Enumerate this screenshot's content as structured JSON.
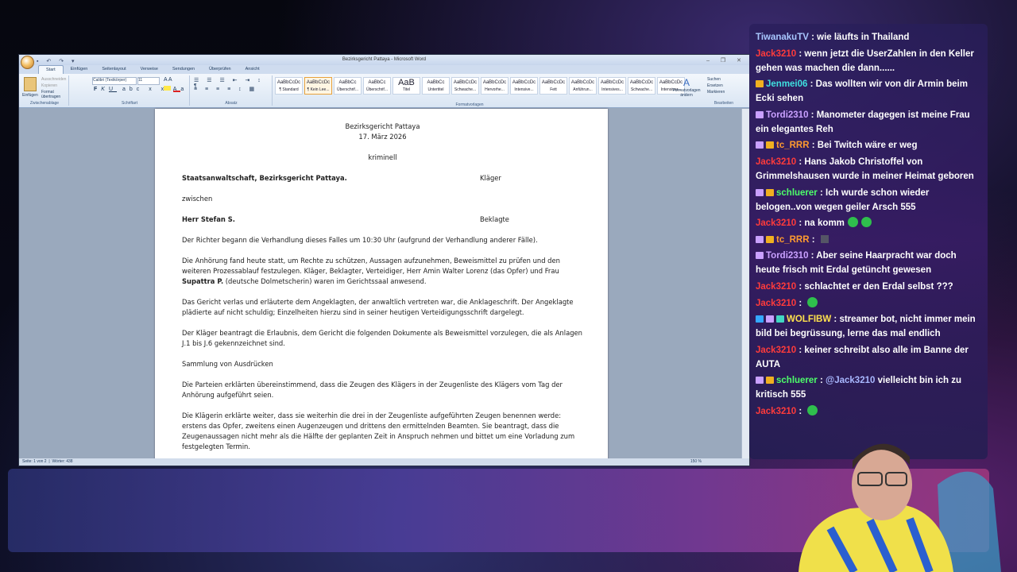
{
  "word": {
    "window_title": "Bezirksgericht Pattaya - Microsoft Word",
    "tabs": [
      "Start",
      "Einfügen",
      "Seitenlayout",
      "Verweise",
      "Sendungen",
      "Überprüfen",
      "Ansicht"
    ],
    "clipboard": {
      "paste": "Einfügen",
      "cut": "Ausschneiden",
      "copy": "Kopieren",
      "format_painter": "Format übertragen",
      "group": "Zwischenablage"
    },
    "font": {
      "name": "Calibri (Textkörper)",
      "size": "11",
      "group": "Schriftart"
    },
    "paragraph_group": "Absatz",
    "styles": [
      {
        "preview": "AaBbCcDc",
        "name": "¶ Standard"
      },
      {
        "preview": "AaBbCcDc",
        "name": "¶ Kein Lee..."
      },
      {
        "preview": "AaBbCc",
        "name": "Überschrif..."
      },
      {
        "preview": "AaBbCc",
        "name": "Überschrif..."
      },
      {
        "preview": "AaB",
        "name": "Titel"
      },
      {
        "preview": "AaBbCc",
        "name": "Untertitel"
      },
      {
        "preview": "AaBbCcDc",
        "name": "Schwache..."
      },
      {
        "preview": "AaBbCcDc",
        "name": "Hervorhe..."
      },
      {
        "preview": "AaBbCcDc",
        "name": "Intensive..."
      },
      {
        "preview": "AaBbCcDc",
        "name": "Fett"
      },
      {
        "preview": "AaBbCcDc",
        "name": "Anführun..."
      },
      {
        "preview": "AaBbCcDc",
        "name": "Intensives..."
      },
      {
        "preview": "AaBbCcDc",
        "name": "Schwache..."
      },
      {
        "preview": "AaBbCcDc",
        "name": "Intensiver..."
      }
    ],
    "styles_group": "Formatvorlagen",
    "change_styles": "Formatvorlagen ändern",
    "editing": {
      "find": "Suchen",
      "replace": "Ersetzen",
      "select": "Markieren",
      "group": "Bearbeiten"
    },
    "status": {
      "page": "Seite: 1 von 2",
      "words": "Wörter: 438",
      "zoom": "150 %"
    },
    "document": {
      "heading": "Bezirksgericht Pattaya",
      "date": "17. März 2026",
      "category": "kriminell",
      "party1": "Staatsanwaltschaft, Bezirksgericht Pattaya.",
      "party1_role": "Kläger",
      "between": "zwischen",
      "party2": "Herr Stefan S.",
      "party2_role": "Beklagte",
      "p1": "Der Richter begann die Verhandlung dieses Falles um 10:30 Uhr (aufgrund der Verhandlung anderer Fälle).",
      "p2a": "Die Anhörung fand heute statt, um Rechte zu schützen, Aussagen aufzunehmen, Beweismittel zu prüfen und den weiteren Prozessablauf festzulegen. Kläger, Beklagter, Verteidiger, Herr Amin Walter Lorenz (das Opfer) und Frau ",
      "p2b": "Supattra P.",
      "p2c": " (deutsche Dolmetscherin) waren im Gerichtssaal anwesend.",
      "p3": "Das Gericht verlas und erläuterte dem Angeklagten, der anwaltlich vertreten war, die Anklageschrift. Der Angeklagte plädierte auf nicht schuldig; Einzelheiten hierzu sind in seiner heutigen Verteidigungsschrift dargelegt.",
      "p4": "Der Kläger beantragt die Erlaubnis, dem Gericht die folgenden Dokumente als Beweismittel vorzulegen, die als Anlagen J.1 bis J.6 gekennzeichnet sind.",
      "p5": "Sammlung von Ausdrücken",
      "p6": "Die Parteien erklärten übereinstimmend, dass die Zeugen des Klägers in der Zeugenliste des Klägers vom Tag der Anhörung aufgeführt seien.",
      "p7": "Die Klägerin erklärte weiter, dass sie weiterhin die drei in der Zeugenliste aufgeführten Zeugen benennen werde: erstens das Opfer, zweitens einen Augenzeugen und drittens den ermittelnden Beamten. Sie beantragt, dass die Zeugenaussagen nicht mehr als die Hälfte der geplanten Zeit in Anspruch nehmen und bittet um eine Vorladung zum festgelegten Termin."
    }
  },
  "chat": [
    {
      "user": "TiwanakuTV",
      "color": "#a9c8ff",
      "badges": [],
      "text": "wie läufts in Thailand"
    },
    {
      "user": "Jack3210",
      "color": "#ff3b3b",
      "badges": [],
      "text": "wenn jetzt die UserZahlen in den Keller gehen was machen die dann......"
    },
    {
      "user": "Jenmei06",
      "color": "#3fe0e0",
      "badges": [
        "gold"
      ],
      "text": "Das wollten wir von dir Armin beim Ecki sehen"
    },
    {
      "user": "Tordi2310",
      "color": "#c9a0ff",
      "badges": [
        "purple"
      ],
      "text": "Manometer dagegen ist meine Frau ein elegantes Reh"
    },
    {
      "user": "tc_RRR",
      "color": "#ff9b2f",
      "badges": [
        "purple",
        "gold"
      ],
      "text": "Bei Twitch wäre er weg"
    },
    {
      "user": "Jack3210",
      "color": "#ff3b3b",
      "badges": [],
      "text": "Hans Jakob Christoffel von Grimmelshausen wurde in meiner Heimat geboren"
    },
    {
      "user": "schluerer",
      "color": "#4dff6a",
      "badges": [
        "purple",
        "gold"
      ],
      "text": "Ich wurde schon wieder belogen..von wegen geiler Arsch 555"
    },
    {
      "user": "Jack3210",
      "color": "#ff3b3b",
      "badges": [],
      "text": "na komm",
      "emotes": 2
    },
    {
      "user": "tc_RRR",
      "color": "#ff9b2f",
      "badges": [
        "purple",
        "gold"
      ],
      "text": "",
      "dark_emote": true
    },
    {
      "user": "Tordi2310",
      "color": "#c9a0ff",
      "badges": [
        "purple"
      ],
      "text": "Aber seine Haarpracht war doch heute frisch mit Erdal getüncht gewesen"
    },
    {
      "user": "Jack3210",
      "color": "#ff3b3b",
      "badges": [],
      "text": "schlachtet er den Erdal selbst ???"
    },
    {
      "user": "Jack3210",
      "color": "#ff3b3b",
      "badges": [],
      "text": "",
      "emotes": 1
    },
    {
      "user": "WOLFIBW",
      "color": "#ffe14d",
      "badges": [
        "blue",
        "purple",
        "gem"
      ],
      "text": "streamer bot, nicht immer mein bild bei begrüssung, lerne das mal endlich"
    },
    {
      "user": "Jack3210",
      "color": "#ff3b3b",
      "badges": [],
      "text": "keiner schreibt also alle im Banne der AUTA"
    },
    {
      "user": "schluerer",
      "color": "#4dff6a",
      "badges": [
        "purple",
        "gold"
      ],
      "mention": "@Jack3210",
      "text": "vielleicht bin ich zu kritisch 555"
    },
    {
      "user": "Jack3210",
      "color": "#ff3b3b",
      "badges": [],
      "text": "",
      "emotes": 1
    }
  ]
}
